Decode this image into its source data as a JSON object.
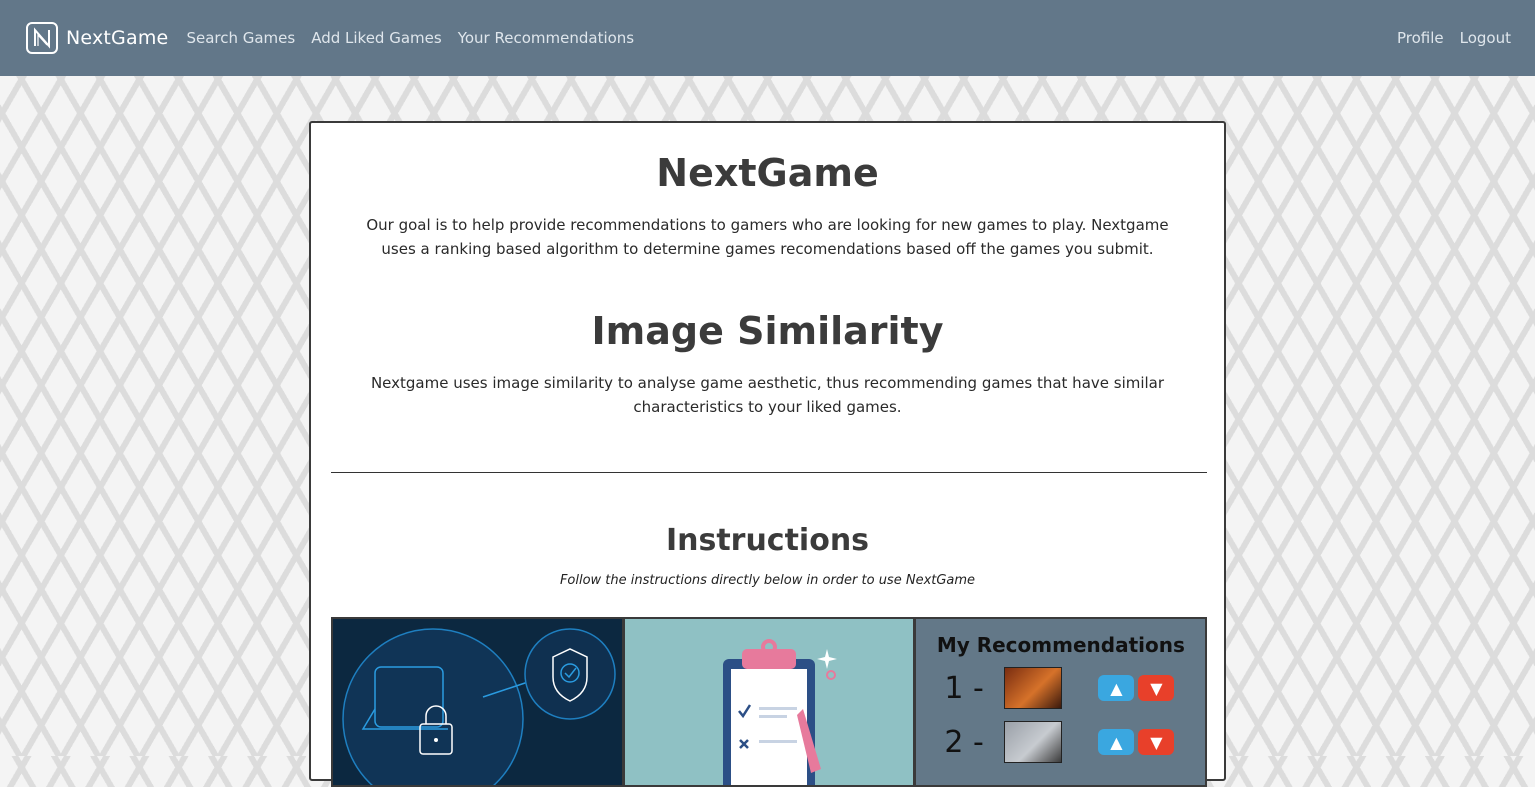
{
  "navbar": {
    "brand": "NextGame",
    "links": [
      "Search Games",
      "Add Liked Games",
      "Your Recommendations"
    ],
    "right_links": [
      "Profile",
      "Logout"
    ]
  },
  "main": {
    "title": "NextGame",
    "intro": "Our goal is to help provide recommendations to gamers who are looking for new games to play. Nextgame uses a ranking based algorithm to determine games recomendations based off the games you submit.",
    "similarity_title": "Image Similarity",
    "similarity_text": "Nextgame uses image similarity to analyse game aesthetic, thus recommending games that have similar characteristics to your liked games.",
    "instructions_title": "Instructions",
    "instructions_subtitle": "Follow the instructions directly below in order to use NextGame"
  },
  "panels": {
    "recommendations": {
      "title": "My Recommendations",
      "rows": [
        {
          "rank": "1 -"
        },
        {
          "rank": "2 -"
        }
      ]
    }
  },
  "colors": {
    "navbar": "#627789",
    "thumb_up": "#3aa7e0",
    "thumb_down": "#e8402a"
  }
}
